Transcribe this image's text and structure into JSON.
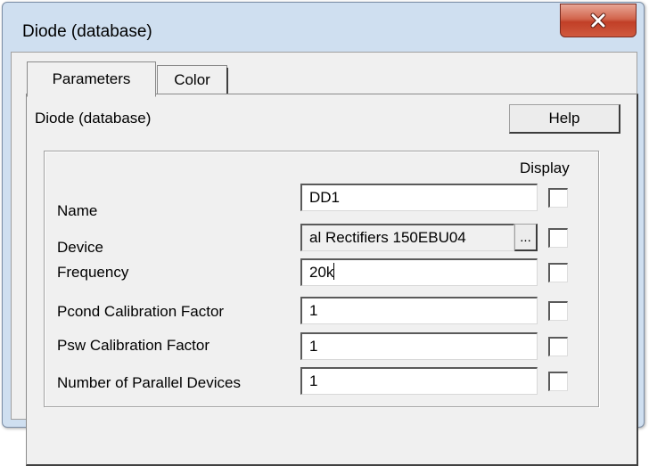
{
  "window": {
    "title": "Diode (database)"
  },
  "tabs": [
    {
      "label": "Parameters",
      "selected": true
    },
    {
      "label": "Color",
      "selected": false
    }
  ],
  "panel": {
    "header": "Diode (database)",
    "help_label": "Help",
    "display_header": "Display"
  },
  "rows": [
    {
      "label": "Name",
      "value": "DD1",
      "display_checked": false
    },
    {
      "label": "Device",
      "value": "al Rectifiers 150EBU04",
      "browse_label": "...",
      "display_checked": false
    },
    {
      "label": "Frequency",
      "value": "20k",
      "display_checked": false
    },
    {
      "label": "Pcond Calibration Factor",
      "value": "1",
      "display_checked": false
    },
    {
      "label": "Psw Calibration Factor",
      "value": "1",
      "display_checked": false
    },
    {
      "label": "Number of Parallel Devices",
      "value": "1",
      "display_checked": false
    }
  ],
  "colors": {
    "title_bar": "#cfdff0",
    "close_button": "#c9452c",
    "dialog_bg": "#f0f0f0"
  },
  "icons": {
    "close": "close-icon"
  }
}
